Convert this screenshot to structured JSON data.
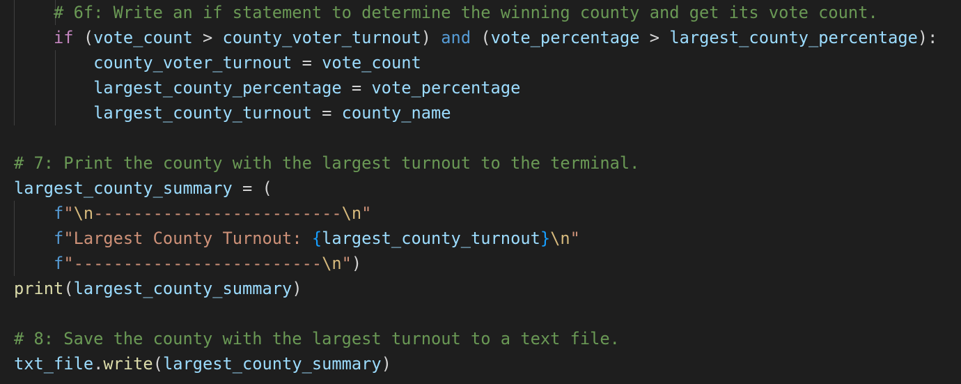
{
  "code_lines": [
    [
      {
        "text": "    # 6f: Write an if statement to determine the winning county and get its vote count.",
        "kind": "comment"
      }
    ],
    [
      {
        "text": "    ",
        "kind": "plain"
      },
      {
        "text": "if",
        "kind": "keyword"
      },
      {
        "text": " (",
        "kind": "plain"
      },
      {
        "text": "vote_count",
        "kind": "variable"
      },
      {
        "text": " > ",
        "kind": "plain"
      },
      {
        "text": "county_voter_turnout",
        "kind": "variable"
      },
      {
        "text": ") ",
        "kind": "plain"
      },
      {
        "text": "and",
        "kind": "operator-keyword"
      },
      {
        "text": " (",
        "kind": "plain"
      },
      {
        "text": "vote_percentage",
        "kind": "variable"
      },
      {
        "text": " > ",
        "kind": "plain"
      },
      {
        "text": "largest_county_percentage",
        "kind": "variable"
      },
      {
        "text": "):",
        "kind": "plain"
      }
    ],
    [
      {
        "text": "        ",
        "kind": "plain"
      },
      {
        "text": "county_voter_turnout",
        "kind": "variable"
      },
      {
        "text": " = ",
        "kind": "plain"
      },
      {
        "text": "vote_count",
        "kind": "variable"
      }
    ],
    [
      {
        "text": "        ",
        "kind": "plain"
      },
      {
        "text": "largest_county_percentage",
        "kind": "variable"
      },
      {
        "text": " = ",
        "kind": "plain"
      },
      {
        "text": "vote_percentage",
        "kind": "variable"
      }
    ],
    [
      {
        "text": "        ",
        "kind": "plain"
      },
      {
        "text": "largest_county_turnout",
        "kind": "variable"
      },
      {
        "text": " = ",
        "kind": "plain"
      },
      {
        "text": "county_name",
        "kind": "variable"
      }
    ],
    [],
    [
      {
        "text": "# 7: Print the county with the largest turnout to the terminal.",
        "kind": "comment"
      }
    ],
    [
      {
        "text": "largest_county_summary",
        "kind": "variable"
      },
      {
        "text": " = (",
        "kind": "plain"
      }
    ],
    [
      {
        "text": "    ",
        "kind": "plain"
      },
      {
        "text": "f",
        "kind": "string-prefix"
      },
      {
        "text": "\"",
        "kind": "string"
      },
      {
        "text": "\\n",
        "kind": "escape"
      },
      {
        "text": "-------------------------",
        "kind": "string"
      },
      {
        "text": "\\n",
        "kind": "escape"
      },
      {
        "text": "\"",
        "kind": "string"
      }
    ],
    [
      {
        "text": "    ",
        "kind": "plain"
      },
      {
        "text": "f",
        "kind": "string-prefix"
      },
      {
        "text": "\"Largest County Turnout: ",
        "kind": "string"
      },
      {
        "text": "{",
        "kind": "brace"
      },
      {
        "text": "largest_county_turnout",
        "kind": "variable"
      },
      {
        "text": "}",
        "kind": "brace"
      },
      {
        "text": "\\n",
        "kind": "escape"
      },
      {
        "text": "\"",
        "kind": "string"
      }
    ],
    [
      {
        "text": "    ",
        "kind": "plain"
      },
      {
        "text": "f",
        "kind": "string-prefix"
      },
      {
        "text": "\"-------------------------",
        "kind": "string"
      },
      {
        "text": "\\n",
        "kind": "escape"
      },
      {
        "text": "\"",
        "kind": "string"
      },
      {
        "text": ")",
        "kind": "plain"
      }
    ],
    [
      {
        "text": "print",
        "kind": "function"
      },
      {
        "text": "(",
        "kind": "plain"
      },
      {
        "text": "largest_county_summary",
        "kind": "variable"
      },
      {
        "text": ")",
        "kind": "plain"
      }
    ],
    [],
    [
      {
        "text": "# 8: Save the county with the largest turnout to a text file.",
        "kind": "comment"
      }
    ],
    [
      {
        "text": "txt_file",
        "kind": "variable"
      },
      {
        "text": ".",
        "kind": "plain"
      },
      {
        "text": "write",
        "kind": "function"
      },
      {
        "text": "(",
        "kind": "plain"
      },
      {
        "text": "largest_county_summary",
        "kind": "variable"
      },
      {
        "text": ")",
        "kind": "plain"
      }
    ]
  ],
  "theme": {
    "background": "#1e1e1e",
    "comment": "#6a9955",
    "keyword": "#c586c0",
    "operator_keyword": "#569cd6",
    "variable": "#9cdcfe",
    "function": "#dcdcaa",
    "string": "#ce9178",
    "escape": "#d7ba7d",
    "indent_guide": "#404040"
  }
}
